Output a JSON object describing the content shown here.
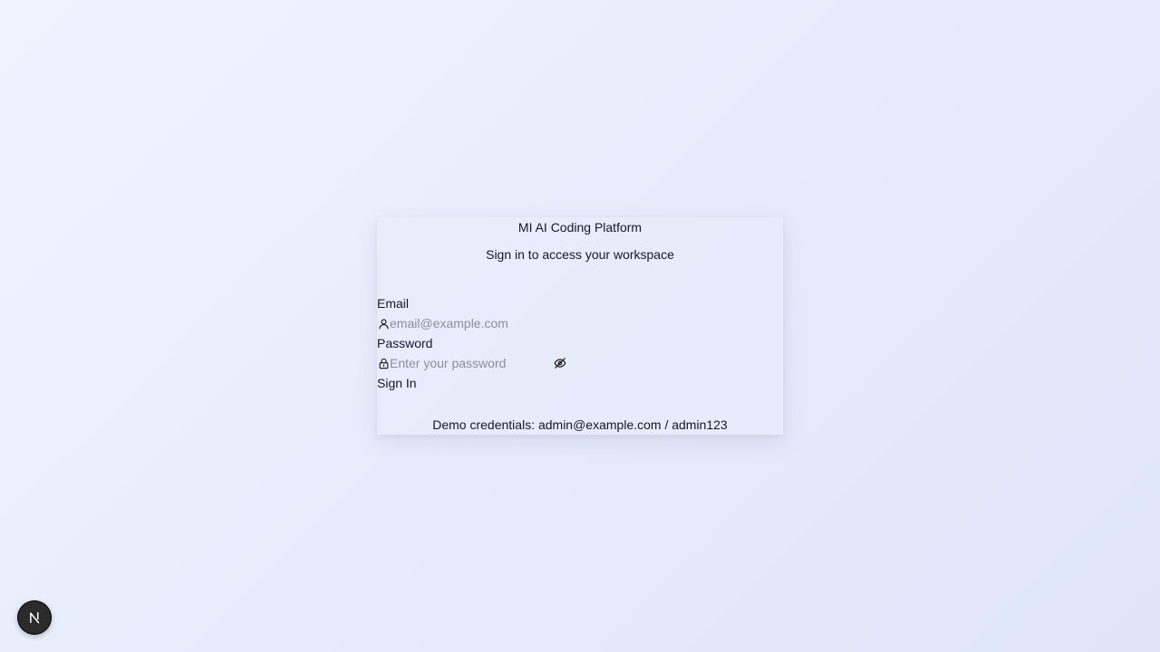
{
  "login": {
    "title": "MI AI Coding Platform",
    "subtitle": "Sign in to access your workspace",
    "email": {
      "label": "Email",
      "placeholder": "email@example.com",
      "value": "",
      "icon": "user-icon"
    },
    "password": {
      "label": "Password",
      "placeholder": "Enter your password",
      "value": "",
      "icon": "lock-icon",
      "toggle_icon": "eye-off-icon"
    },
    "submit_label": "Sign In",
    "demo_text": "Demo credentials: admin@example.com / admin123"
  },
  "dev_badge": {
    "icon": "nextjs-logo-icon"
  }
}
